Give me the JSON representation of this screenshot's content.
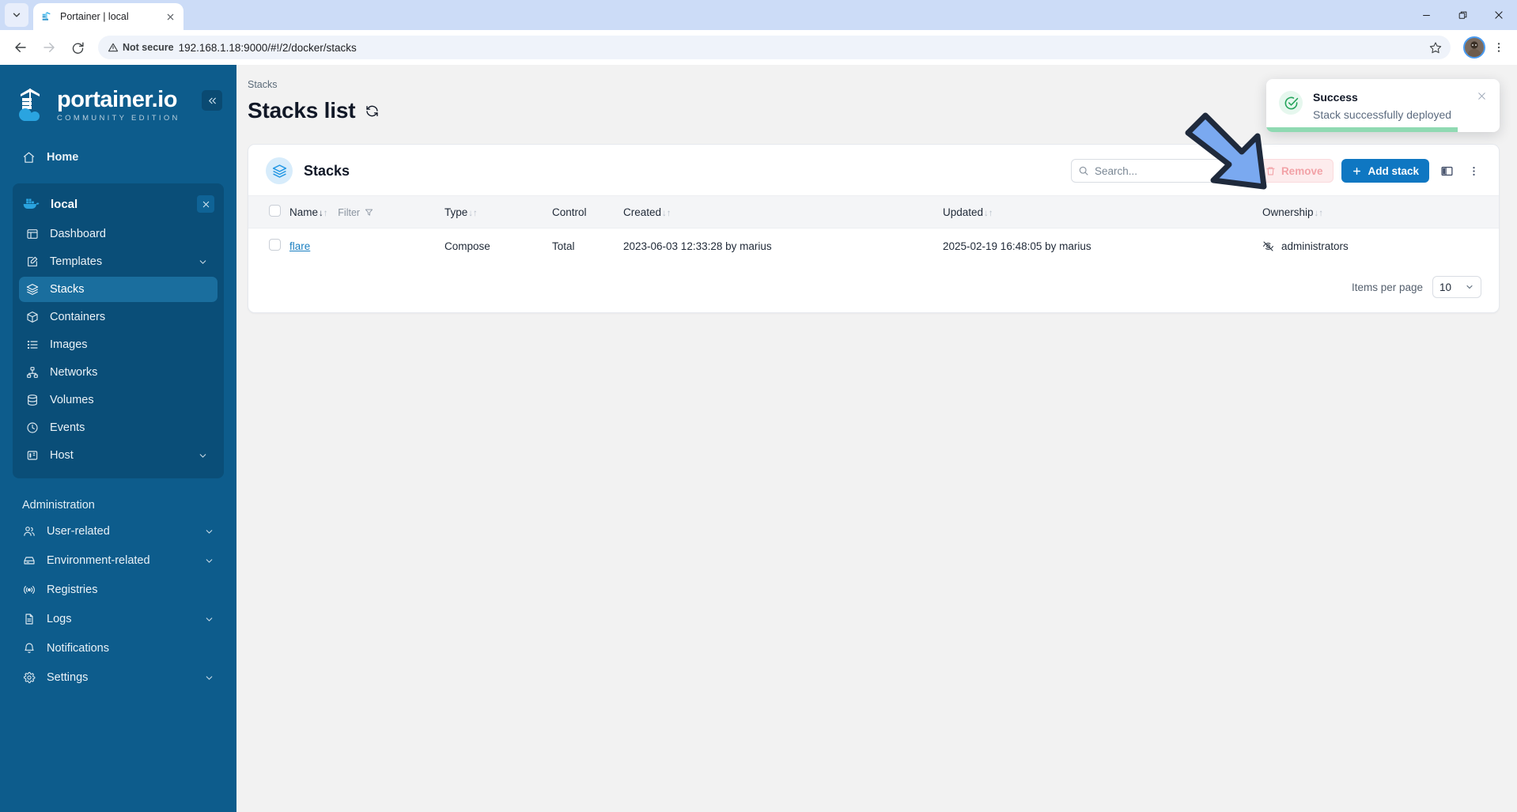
{
  "browser": {
    "tab": {
      "title": "Portainer | local",
      "favicon_icon": "portainer-favicon",
      "close_icon": "close-icon"
    },
    "tablist_chevron_icon": "chevron-down-icon",
    "window": {
      "minimize_icon": "minimize-icon",
      "restore_icon": "restore-icon",
      "close_icon": "close-icon"
    },
    "nav": {
      "back_icon": "back-arrow-icon",
      "forward_icon": "forward-arrow-icon",
      "reload_icon": "reload-icon"
    },
    "omnibox": {
      "security_label": "Not secure",
      "security_icon": "warning-triangle-icon",
      "url": "192.168.1.18:9000/#!/2/docker/stacks",
      "bookmark_icon": "star-icon"
    },
    "profile_icon": "avatar",
    "menu_icon": "kebab-menu-icon"
  },
  "sidebar": {
    "logo": {
      "word": "portainer.io",
      "subtitle": "COMMUNITY EDITION",
      "icon": "portainer-crane-logo"
    },
    "collapse": {
      "icon": "chevron-double-left-icon"
    },
    "home": {
      "label": "Home",
      "icon": "home-icon"
    },
    "environment": {
      "name": "local",
      "icon": "docker-whale-icon",
      "close_icon": "close-icon",
      "items": [
        {
          "label": "Dashboard",
          "icon": "dashboard-icon",
          "chevron": "",
          "active": false
        },
        {
          "label": "Templates",
          "icon": "template-edit-icon",
          "chevron": "chevron-down-icon",
          "active": false
        },
        {
          "label": "Stacks",
          "icon": "stacks-layers-icon",
          "chevron": "",
          "active": true
        },
        {
          "label": "Containers",
          "icon": "container-box-icon",
          "chevron": "",
          "active": false
        },
        {
          "label": "Images",
          "icon": "images-list-icon",
          "chevron": "",
          "active": false
        },
        {
          "label": "Networks",
          "icon": "networks-icon",
          "chevron": "",
          "active": false
        },
        {
          "label": "Volumes",
          "icon": "volumes-database-icon",
          "chevron": "",
          "active": false
        },
        {
          "label": "Events",
          "icon": "events-clock-icon",
          "chevron": "",
          "active": false
        },
        {
          "label": "Host",
          "icon": "host-server-icon",
          "chevron": "chevron-down-icon",
          "active": false
        }
      ]
    },
    "admin_title": "Administration",
    "admin_items": [
      {
        "label": "User-related",
        "icon": "users-icon",
        "chevron": "chevron-down-icon"
      },
      {
        "label": "Environment-related",
        "icon": "environment-icon",
        "chevron": "chevron-down-icon"
      },
      {
        "label": "Registries",
        "icon": "registries-broadcast-icon",
        "chevron": ""
      },
      {
        "label": "Logs",
        "icon": "logs-document-icon",
        "chevron": "chevron-down-icon"
      },
      {
        "label": "Notifications",
        "icon": "bell-icon",
        "chevron": ""
      },
      {
        "label": "Settings",
        "icon": "gear-icon",
        "chevron": "chevron-down-icon"
      }
    ]
  },
  "main": {
    "breadcrumb": "Stacks",
    "page_title": "Stacks list",
    "refresh_icon": "refresh-icon",
    "card": {
      "icon": "stacks-layers-icon",
      "title": "Stacks",
      "search": {
        "placeholder": "Search...",
        "value": "",
        "icon": "search-icon",
        "clear_icon": "close-icon"
      },
      "remove_button": {
        "label": "Remove",
        "icon": "trash-icon"
      },
      "add_button": {
        "label": "Add stack",
        "icon": "plus-icon"
      },
      "columns_button_icon": "columns-layout-icon",
      "more_button_icon": "kebab-menu-icon",
      "table": {
        "select_all_checkbox": "checkbox",
        "columns": [
          {
            "label": "Name",
            "sortable": true,
            "sorted": "asc",
            "filter": "Filter",
            "filter_icon": "funnel-icon"
          },
          {
            "label": "Type",
            "sortable": true,
            "sorted": ""
          },
          {
            "label": "Control",
            "sortable": false,
            "sorted": ""
          },
          {
            "label": "Created",
            "sortable": true,
            "sorted": ""
          },
          {
            "label": "Updated",
            "sortable": true,
            "sorted": ""
          },
          {
            "label": "Ownership",
            "sortable": true,
            "sorted": ""
          }
        ],
        "rows": [
          {
            "name": "flare",
            "type": "Compose",
            "control": "Total",
            "created": "2023-06-03 12:33:28 by marius",
            "updated": "2025-02-19 16:48:05 by marius",
            "ownership": "administrators",
            "ownership_icon": "eye-off-icon"
          }
        ]
      },
      "footer": {
        "items_per_page_label": "Items per page",
        "items_per_page_value": "10",
        "chevron_icon": "chevron-down-icon"
      }
    }
  },
  "toast": {
    "title": "Success",
    "message": "Stack successfully deployed",
    "status_icon": "check-circle-icon",
    "close_icon": "close-icon",
    "progress_percent": 82
  },
  "annotation": {
    "arrow_icon": "pointer-arrow-icon"
  },
  "colors": {
    "sidebar_bg": "#0d5c8c",
    "sidebar_group_bg": "#0a4e78",
    "sidebar_active": "#1a6e9e",
    "accent_blue": "#0f77c2",
    "link_blue": "#1a7fc1",
    "success_green": "#23a35a",
    "toast_progress": "#8fd9b2",
    "remove_pink": "#fdeced",
    "page_bg": "#f2f2f2",
    "arrow_fill": "#7aa9f0",
    "arrow_stroke": "#1f2a3c"
  }
}
